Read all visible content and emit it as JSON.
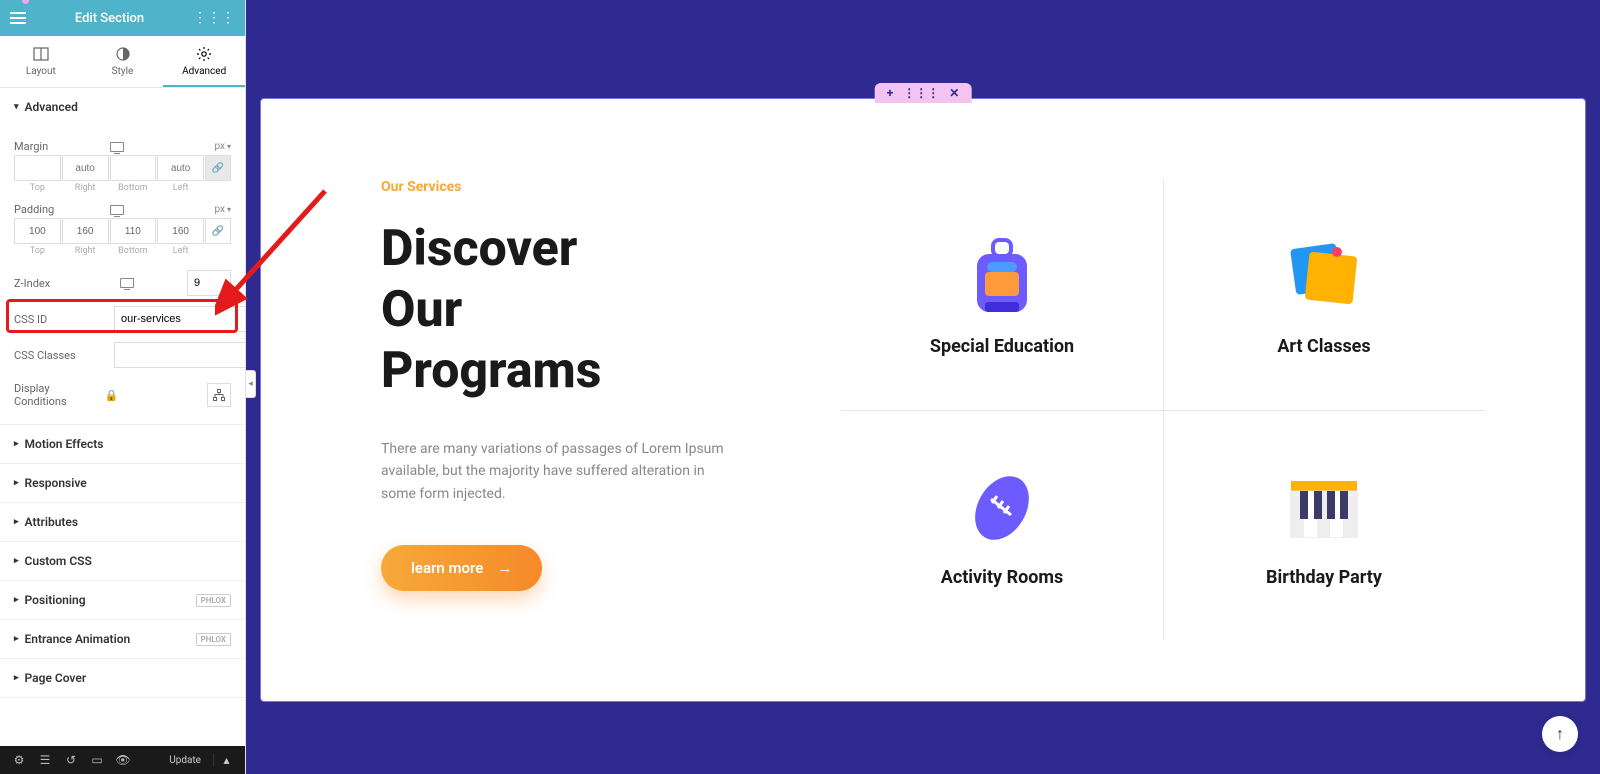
{
  "header": {
    "title": "Edit Section"
  },
  "tabs": {
    "layout": "Layout",
    "style": "Style",
    "advanced": "Advanced",
    "active": "Advanced"
  },
  "advanced": {
    "title": "Advanced",
    "margin": {
      "label": "Margin",
      "unit": "px",
      "top": "",
      "right": "",
      "bottom": "",
      "left": "",
      "top_ph": "",
      "right_ph": "auto",
      "bottom_ph": "",
      "left_ph": "auto",
      "dl_top": "Top",
      "dl_right": "Right",
      "dl_bottom": "Bottom",
      "dl_left": "Left"
    },
    "padding": {
      "label": "Padding",
      "unit": "px",
      "top": "100",
      "right": "160",
      "bottom": "110",
      "left": "160",
      "dl_top": "Top",
      "dl_right": "Right",
      "dl_bottom": "Bottom",
      "dl_left": "Left"
    },
    "zindex": {
      "label": "Z-Index",
      "value": "9"
    },
    "css_id": {
      "label": "CSS ID",
      "value": "our-services"
    },
    "css_classes": {
      "label": "CSS Classes",
      "value": ""
    },
    "display_conditions": {
      "label": "Display Conditions"
    }
  },
  "sections": {
    "motion": "Motion Effects",
    "responsive": "Responsive",
    "attributes": "Attributes",
    "custom_css": "Custom CSS",
    "positioning": "Positioning",
    "entrance": "Entrance Animation",
    "page_cover": "Page Cover",
    "badge": "PHLOX"
  },
  "footer": {
    "update": "Update"
  },
  "preview": {
    "eyebrow": "Our Services",
    "headline_l1": "Discover",
    "headline_l2": "Our",
    "headline_l3": "Programs",
    "desc": "There are many variations of passages of Lorem Ipsum available, but the majority have suffered alteration in some form injected.",
    "cta": "learn more",
    "cards": {
      "special_education": "Special Education",
      "art_classes": "Art Classes",
      "activity_rooms": "Activity Rooms",
      "birthday_party": "Birthday Party"
    }
  }
}
